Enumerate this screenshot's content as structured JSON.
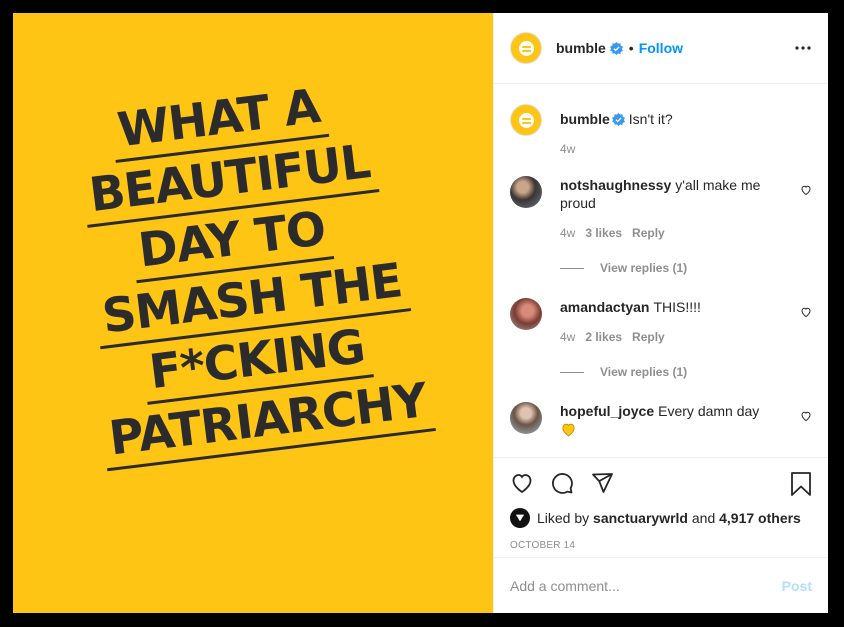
{
  "poster": {
    "lines": [
      "WHAT A",
      "BEAUTIFUL",
      "DAY TO",
      "SMASH THE",
      "F*CKING",
      "PATRIARCHY"
    ]
  },
  "header": {
    "username": "bumble",
    "separator": "•",
    "follow_label": "Follow"
  },
  "caption": {
    "username": "bumble",
    "text": "Isn't it?",
    "age": "4w"
  },
  "comments": [
    {
      "username": "notshaughnessy",
      "text": "y'all make me proud",
      "age": "4w",
      "likes": "3 likes",
      "reply": "Reply",
      "view_replies": "View replies (1)"
    },
    {
      "username": "amandactyan",
      "text": "THIS!!!!",
      "age": "4w",
      "likes": "2 likes",
      "reply": "Reply",
      "view_replies": "View replies (1)"
    },
    {
      "username": "hopeful_joyce",
      "text": "Every damn day"
    }
  ],
  "likes": {
    "prefix": "Liked by",
    "user": "sanctuarywrld",
    "and": "and",
    "others": "4,917 others"
  },
  "date": "OCTOBER 14",
  "add_comment": {
    "placeholder": "Add a comment...",
    "post_label": "Post"
  },
  "colors": {
    "brand_yellow": "#FEC514",
    "link_blue": "#0095f6",
    "post_disabled": "#b2dffc"
  }
}
